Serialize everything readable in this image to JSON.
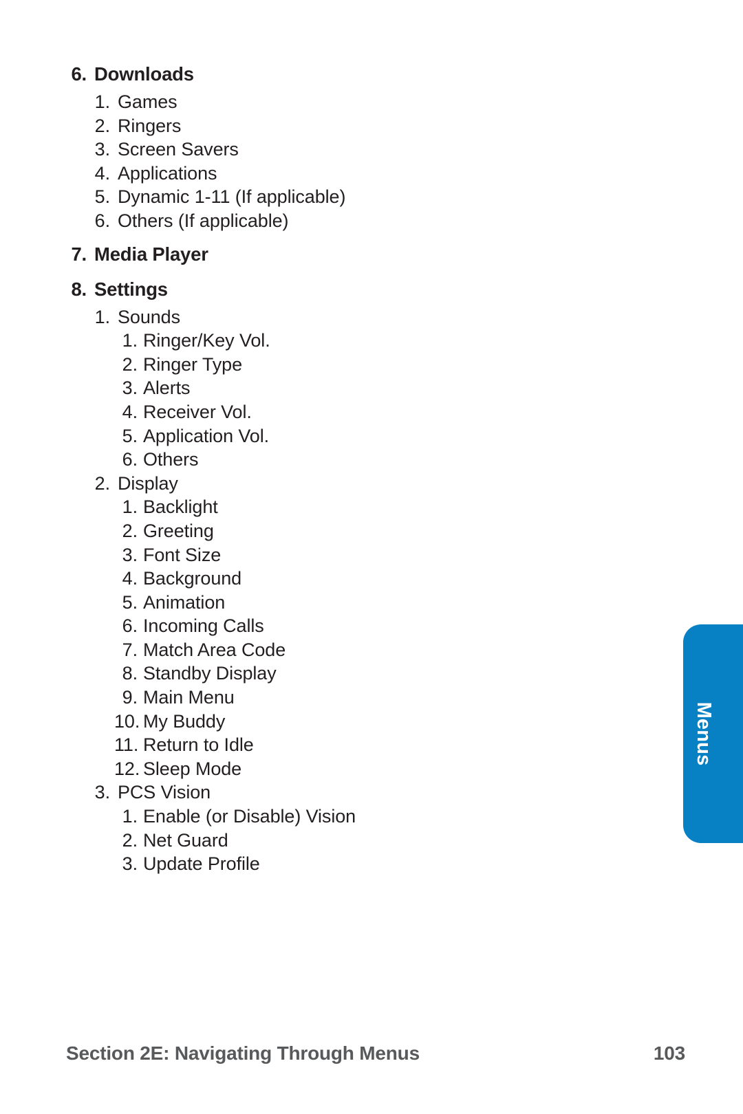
{
  "page": {
    "number": "103",
    "section_footer": "Section 2E: Navigating Through Menus"
  },
  "thumb_tab": {
    "label": "Menus",
    "color": "#0780c4",
    "text_color": "#ffffff"
  },
  "outline": [
    {
      "level": 1,
      "num": "6.",
      "label": "Downloads",
      "children": [
        {
          "level": 2,
          "num": "1.",
          "label": "Games"
        },
        {
          "level": 2,
          "num": "2.",
          "label": "Ringers"
        },
        {
          "level": 2,
          "num": "3.",
          "label": "Screen Savers"
        },
        {
          "level": 2,
          "num": "4.",
          "label": "Applications"
        },
        {
          "level": 2,
          "num": "5.",
          "label": "Dynamic 1-11 (If applicable)"
        },
        {
          "level": 2,
          "num": "6.",
          "label": "Others (If applicable)"
        }
      ]
    },
    {
      "level": 1,
      "num": "7.",
      "label": "Media Player",
      "children": []
    },
    {
      "level": 1,
      "num": "8.",
      "label": "Settings",
      "children": [
        {
          "level": 2,
          "num": "1.",
          "label": "Sounds"
        },
        {
          "level": 3,
          "num": "1.",
          "label": "Ringer/Key Vol."
        },
        {
          "level": 3,
          "num": "2.",
          "label": "Ringer Type"
        },
        {
          "level": 3,
          "num": "3.",
          "label": "Alerts"
        },
        {
          "level": 3,
          "num": "4.",
          "label": "Receiver Vol."
        },
        {
          "level": 3,
          "num": "5.",
          "label": "Application Vol."
        },
        {
          "level": 3,
          "num": "6.",
          "label": "Others"
        },
        {
          "level": 2,
          "num": "2.",
          "label": "Display"
        },
        {
          "level": 3,
          "num": "1.",
          "label": "Backlight"
        },
        {
          "level": 3,
          "num": "2.",
          "label": "Greeting"
        },
        {
          "level": 3,
          "num": "3.",
          "label": "Font Size"
        },
        {
          "level": 3,
          "num": "4.",
          "label": "Background"
        },
        {
          "level": 3,
          "num": "5.",
          "label": "Animation"
        },
        {
          "level": 3,
          "num": "6.",
          "label": "Incoming Calls"
        },
        {
          "level": 3,
          "num": "7.",
          "label": "Match Area Code"
        },
        {
          "level": 3,
          "num": "8.",
          "label": "Standby Display"
        },
        {
          "level": 3,
          "num": "9.",
          "label": "Main Menu"
        },
        {
          "level": 3,
          "num": "10.",
          "label": "My Buddy"
        },
        {
          "level": 3,
          "num": "11.",
          "label": "Return to Idle"
        },
        {
          "level": 3,
          "num": "12.",
          "label": "Sleep Mode"
        },
        {
          "level": 2,
          "num": "3.",
          "label": "PCS Vision"
        },
        {
          "level": 3,
          "num": "1.",
          "label": "Enable (or Disable) Vision"
        },
        {
          "level": 3,
          "num": "2.",
          "label": "Net Guard"
        },
        {
          "level": 3,
          "num": "3.",
          "label": "Update Profile"
        }
      ]
    }
  ]
}
